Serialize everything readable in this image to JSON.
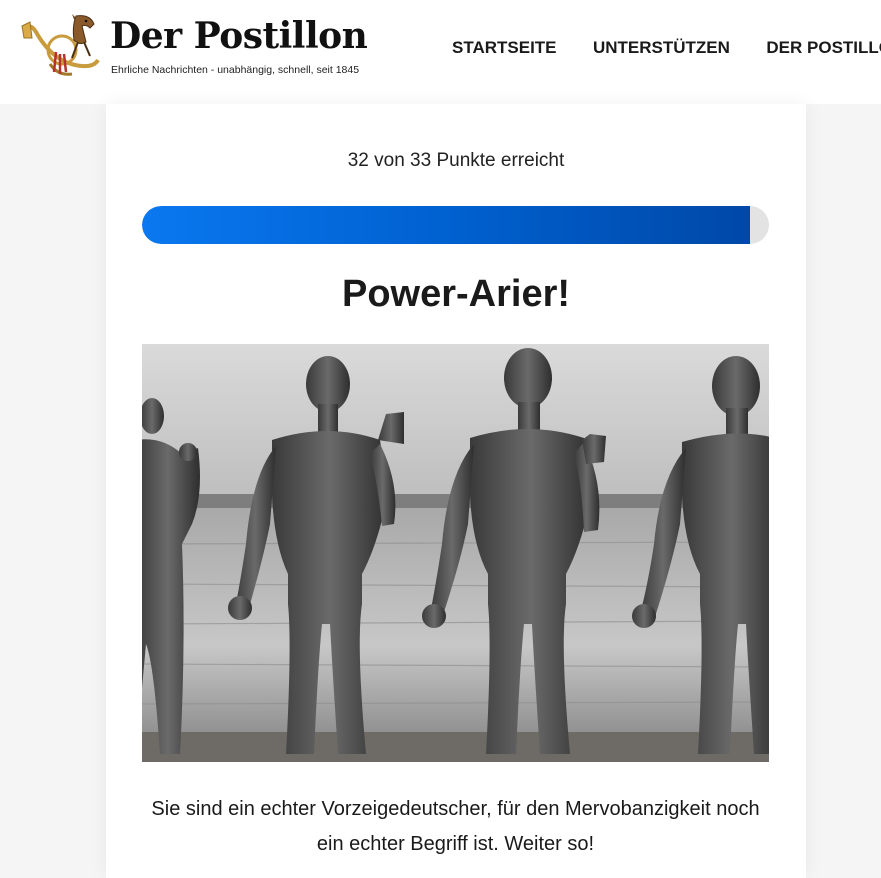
{
  "site": {
    "title": "Der Postillon",
    "tagline": "Ehrliche Nachrichten - unabhängig, schnell, seit 1845"
  },
  "nav": {
    "items": [
      "STARTSEITE",
      "UNTERSTÜTZEN",
      "DER POSTILLON"
    ]
  },
  "quiz": {
    "score_text": "32 von 33 Punkte erreicht",
    "score": 32,
    "max_score": 33,
    "progress_fraction": 0.97,
    "result_title": "Power-Arier!",
    "result_text": "Sie sind ein echter Vorzeigedeutscher, für den Mervobanzigkeit noch ein echter Begriff ist. Weiter so!",
    "image_subject": "black-and-white photo of muscular men posing on a beach"
  },
  "colors": {
    "progress_start": "#0a78f0",
    "progress_end": "#0048a8",
    "progress_track": "#e3e3e3",
    "page_background": "#f5f5f5"
  }
}
